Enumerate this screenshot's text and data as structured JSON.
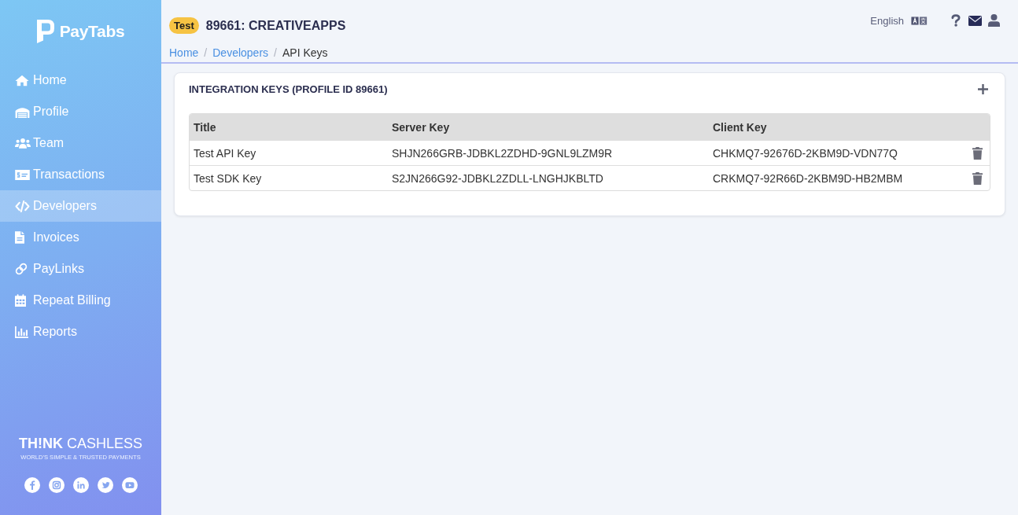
{
  "sidebar": {
    "logo": "PayTabs",
    "items": [
      {
        "label": "Home",
        "selected": false
      },
      {
        "label": "Profile",
        "selected": false
      },
      {
        "label": "Team",
        "selected": false
      },
      {
        "label": "Transactions",
        "selected": false
      },
      {
        "label": "Developers",
        "selected": true
      },
      {
        "label": "Invoices",
        "selected": false
      },
      {
        "label": "PayLinks",
        "selected": false
      },
      {
        "label": "Repeat Billing",
        "selected": false
      },
      {
        "label": "Reports",
        "selected": false
      }
    ],
    "slogan": "**TH!NK** CASHLESS",
    "tagline": "WORLD'S SIMPLE & TRUSTED PAYMENTS"
  },
  "header": {
    "badge": "Test",
    "title": "89661: CREATIVEAPPS",
    "language": "English"
  },
  "breadcrumb": [
    {
      "kind": "link",
      "label": "Home"
    },
    {
      "kind": "separator",
      "label": "/"
    },
    {
      "kind": "link",
      "label": "Developers"
    },
    {
      "kind": "separator",
      "label": "/"
    },
    {
      "kind": "current",
      "label": "API Keys"
    }
  ],
  "card": {
    "title": "INTEGRATION KEYS (PROFILE ID 89661)",
    "table": {
      "columns": [
        "Title",
        "Server Key",
        "Client Key"
      ],
      "rows": [
        [
          "Test API Key",
          "SHJN266GRB-JDBKL2ZDHD-9GNL9LZM9R",
          "CHKMQ7-92676D-2KBM9D-VDN77Q"
        ],
        [
          "Test SDK Key",
          "S2JN266G92-JDBKL2ZDLL-LNGHJKBLTD",
          "CRKMQ7-92R66D-2KBM9D-HB2MBM"
        ]
      ]
    }
  }
}
